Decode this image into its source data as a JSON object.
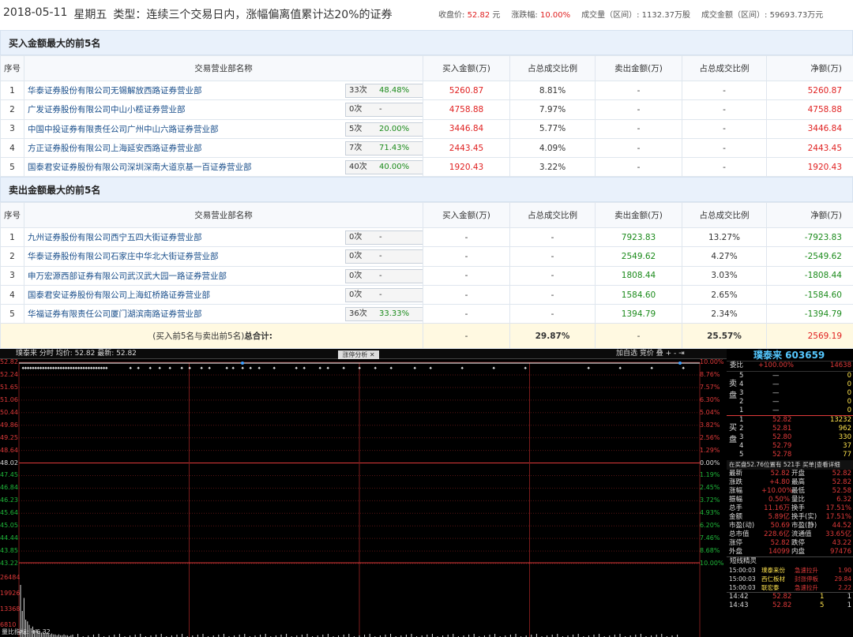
{
  "header": {
    "date": "2018-05-11",
    "weekday": "星期五",
    "type_label": "类型：连续三个交易日内，涨幅偏离值累计达20%的证券",
    "close_label": "收盘价:",
    "close_value": "52.82",
    "close_unit": "元",
    "change_label": "涨跌幅:",
    "change_value": "10.00%",
    "volume_label": "成交量（区间）:",
    "volume_value": "1132.37万股",
    "amount_label": "成交金额（区间）:",
    "amount_value": "59693.73万元"
  },
  "buy_section": {
    "title": "买入金额最大的前5名",
    "columns": [
      "序号",
      "交易营业部名称",
      "买入金额(万)",
      "占总成交比例",
      "卖出金额(万)",
      "占总成交比例",
      "净额(万)"
    ],
    "rows": [
      {
        "idx": "1",
        "name": "华泰证券股份有限公司无锡解放西路证券营业部",
        "times": "33次",
        "rate": "48.48%",
        "buy": "5260.87",
        "buy_pct": "8.81%",
        "sell": "-",
        "sell_pct": "-",
        "net": "5260.87"
      },
      {
        "idx": "2",
        "name": "广发证券股份有限公司中山小榄证券营业部",
        "times": "0次",
        "rate": "-",
        "buy": "4758.88",
        "buy_pct": "7.97%",
        "sell": "-",
        "sell_pct": "-",
        "net": "4758.88"
      },
      {
        "idx": "3",
        "name": "中国中投证券有限责任公司广州中山六路证券营业部",
        "times": "5次",
        "rate": "20.00%",
        "buy": "3446.84",
        "buy_pct": "5.77%",
        "sell": "-",
        "sell_pct": "-",
        "net": "3446.84"
      },
      {
        "idx": "4",
        "name": "方正证券股份有限公司上海延安西路证券营业部",
        "times": "7次",
        "rate": "71.43%",
        "buy": "2443.45",
        "buy_pct": "4.09%",
        "sell": "-",
        "sell_pct": "-",
        "net": "2443.45"
      },
      {
        "idx": "5",
        "name": "国泰君安证券股份有限公司深圳深南大道京基一百证券营业部",
        "times": "40次",
        "rate": "40.00%",
        "buy": "1920.43",
        "buy_pct": "3.22%",
        "sell": "-",
        "sell_pct": "-",
        "net": "1920.43"
      }
    ]
  },
  "sell_section": {
    "title": "卖出金额最大的前5名",
    "columns": [
      "序号",
      "交易营业部名称",
      "买入金额(万)",
      "占总成交比例",
      "卖出金额(万)",
      "占总成交比例",
      "净额(万)"
    ],
    "rows": [
      {
        "idx": "1",
        "name": "九州证券股份有限公司西宁五四大街证券营业部",
        "times": "0次",
        "rate": "-",
        "buy": "-",
        "buy_pct": "-",
        "sell": "7923.83",
        "sell_pct": "13.27%",
        "net": "-7923.83"
      },
      {
        "idx": "2",
        "name": "华泰证券股份有限公司石家庄中华北大街证券营业部",
        "times": "0次",
        "rate": "-",
        "buy": "-",
        "buy_pct": "-",
        "sell": "2549.62",
        "sell_pct": "4.27%",
        "net": "-2549.62"
      },
      {
        "idx": "3",
        "name": "申万宏源西部证券有限公司武汉武大园一路证券营业部",
        "times": "0次",
        "rate": "-",
        "buy": "-",
        "buy_pct": "-",
        "sell": "1808.44",
        "sell_pct": "3.03%",
        "net": "-1808.44"
      },
      {
        "idx": "4",
        "name": "国泰君安证券股份有限公司上海虹桥路证券营业部",
        "times": "0次",
        "rate": "-",
        "buy": "-",
        "buy_pct": "-",
        "sell": "1584.60",
        "sell_pct": "2.65%",
        "net": "-1584.60"
      },
      {
        "idx": "5",
        "name": "华福证券有限责任公司厦门湖滨南路证券营业部",
        "times": "36次",
        "rate": "33.33%",
        "buy": "-",
        "buy_pct": "-",
        "sell": "1394.79",
        "sell_pct": "2.34%",
        "net": "-1394.79"
      }
    ],
    "total": {
      "label": "(买入前5名与卖出前5名)",
      "label_bold": "总合计:",
      "buy": "-",
      "buy_pct": "29.87%",
      "sell": "-",
      "sell_pct": "25.57%",
      "net": "2569.19"
    }
  },
  "chart": {
    "info": "璞泰来 分时 均价: 52.82 最新: 52.82",
    "tab": "涨停分析",
    "tools": "加自选  竞价  叠  + - ⇥",
    "left_labels": [
      "52.82",
      "52.24",
      "51.65",
      "51.06",
      "50.44",
      "49.86",
      "49.25",
      "48.64",
      "48.02",
      "47.45",
      "46.84",
      "46.23",
      "45.64",
      "45.05",
      "44.44",
      "43.85",
      "43.22"
    ],
    "right_labels": [
      "10.00%",
      "8.76%",
      "7.57%",
      "6.30%",
      "5.04%",
      "3.82%",
      "2.56%",
      "1.29%",
      "0.00%",
      "1.19%",
      "2.45%",
      "3.72%",
      "4.93%",
      "6.20%",
      "7.46%",
      "8.68%",
      "10.00%"
    ],
    "vol_labels": [
      "26484",
      "19926",
      "13368",
      "6810"
    ],
    "bottom_label": "量比指标: +6.32",
    "colors": {
      "red": "#e03a3a",
      "white": "#ffffff",
      "blue": "#3fa0ff"
    }
  },
  "side": {
    "title": "璞泰来 603659",
    "weibi_label": "委比",
    "weibi_value": "+100.00%",
    "weibi_count": "14638",
    "sell_side": "卖盘",
    "sells": [
      {
        "n": "5",
        "p": "—",
        "v": "0"
      },
      {
        "n": "4",
        "p": "—",
        "v": "0"
      },
      {
        "n": "3",
        "p": "—",
        "v": "0"
      },
      {
        "n": "2",
        "p": "—",
        "v": "0"
      },
      {
        "n": "1",
        "p": "—",
        "v": "0"
      }
    ],
    "buy_side": "买盘",
    "buys": [
      {
        "n": "1",
        "p": "52.82",
        "v": "13232"
      },
      {
        "n": "2",
        "p": "52.81",
        "v": "962"
      },
      {
        "n": "3",
        "p": "52.80",
        "v": "330"
      },
      {
        "n": "4",
        "p": "52.79",
        "v": "37"
      },
      {
        "n": "5",
        "p": "52.78",
        "v": "77"
      }
    ],
    "note": "在买盘52.76位置有  521手  买单|查看详细",
    "stats": [
      [
        "最新",
        "52.82",
        "开盘",
        "52.82"
      ],
      [
        "涨跌",
        "+4.80",
        "最高",
        "52.82"
      ],
      [
        "涨幅",
        "+10.00%",
        "最低",
        "52.58"
      ],
      [
        "振幅",
        "0.50%",
        "量比",
        "6.32"
      ],
      [
        "总手",
        "11.16万",
        "换手",
        "17.51%"
      ],
      [
        "金额",
        "5.89亿",
        "换手(实)",
        "17.51%"
      ],
      [
        "市盈(动)",
        "50.69",
        "市盈(静)",
        "44.52"
      ],
      [
        "总市值",
        "228.6亿",
        "流通值",
        "33.65亿"
      ],
      [
        "涨停",
        "52.82",
        "跌停",
        "43.22"
      ],
      [
        "外盘",
        "14099",
        "内盘",
        "97476"
      ]
    ],
    "sprite_title": "短线精灵",
    "sprites": [
      [
        "15:00:03",
        "璞泰来份",
        "急速拉升",
        "1.90"
      ],
      [
        "15:00:03",
        "西仁板材",
        "封涨停板",
        "29.84"
      ],
      [
        "15:00:03",
        "联宏泰",
        "急速拉升",
        "2.22"
      ]
    ],
    "ticks": [
      [
        "14:42",
        "52.82",
        "1",
        "1"
      ],
      [
        "14:43",
        "52.82",
        "5",
        "1"
      ]
    ]
  }
}
